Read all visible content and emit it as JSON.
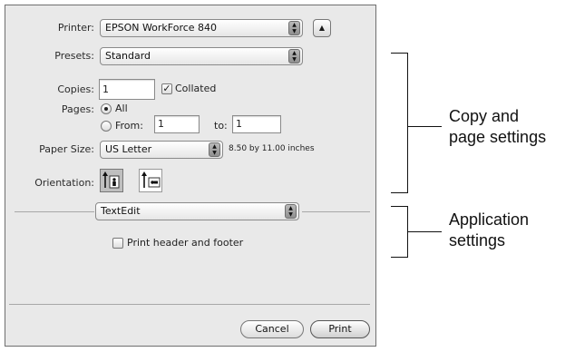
{
  "dialog": {
    "printer": {
      "label": "Printer:",
      "value": "EPSON WorkForce 840"
    },
    "presets": {
      "label": "Presets:",
      "value": "Standard"
    },
    "copies": {
      "label": "Copies:",
      "value": "1",
      "collated_label": "Collated",
      "collated_checked": true
    },
    "pages": {
      "label": "Pages:",
      "all_label": "All",
      "from_label": "From:",
      "from_value": "1",
      "to_label": "to:",
      "to_value": "1",
      "selected": "All"
    },
    "paper_size": {
      "label": "Paper Size:",
      "value": "US Letter",
      "dimensions": "8.50 by 11.00 inches"
    },
    "orientation": {
      "label": "Orientation:",
      "selected": "portrait"
    },
    "section_popup": {
      "value": "TextEdit"
    },
    "print_header_footer": {
      "label": "Print header and footer",
      "checked": false
    },
    "buttons": {
      "cancel": "Cancel",
      "print": "Print"
    }
  },
  "callouts": {
    "copy_page": {
      "line1": "Copy and",
      "line2": "page settings"
    },
    "application": {
      "line1": "Application",
      "line2": "settings"
    }
  }
}
